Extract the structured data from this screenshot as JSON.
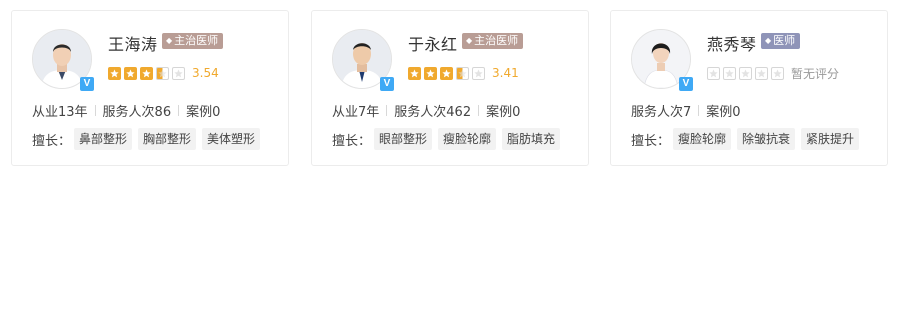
{
  "doctors": [
    {
      "name": "王海涛",
      "title": "主治医师",
      "verified_badge": "V",
      "rating": 3.54,
      "score_text": "3.54",
      "stars": [
        "full",
        "full",
        "full",
        "half",
        "empty"
      ],
      "stats": {
        "experience": "从业13年",
        "service": "服务人次86",
        "cases": "案例0"
      },
      "skills_label": "擅长：",
      "skills": [
        "鼻部整形",
        "胸部整形",
        "美体塑形"
      ]
    },
    {
      "name": "于永红",
      "title": "主治医师",
      "verified_badge": "V",
      "rating": 3.41,
      "score_text": "3.41",
      "stars": [
        "full",
        "full",
        "full",
        "half",
        "empty"
      ],
      "stats": {
        "experience": "从业7年",
        "service": "服务人次462",
        "cases": "案例0"
      },
      "skills_label": "擅长：",
      "skills": [
        "眼部整形",
        "瘦脸轮廓",
        "脂肪填充"
      ]
    },
    {
      "name": "燕秀琴",
      "title": "医师",
      "verified_badge": "V",
      "score_text": "暂无评分",
      "stars": [
        "empty",
        "empty",
        "empty",
        "empty",
        "empty"
      ],
      "stats": {
        "service": "服务人次7",
        "cases": "案例0"
      },
      "skills_label": "擅长：",
      "skills": [
        "瘦脸轮廓",
        "除皱抗衰",
        "紧肤提升"
      ]
    }
  ],
  "colors": {
    "star_active": "#f0a92e",
    "badge_attending": "#b99d95",
    "badge_doctor": "#8f94b8",
    "verified": "#3fa9f5",
    "tag_bg": "#f2f2f2"
  }
}
